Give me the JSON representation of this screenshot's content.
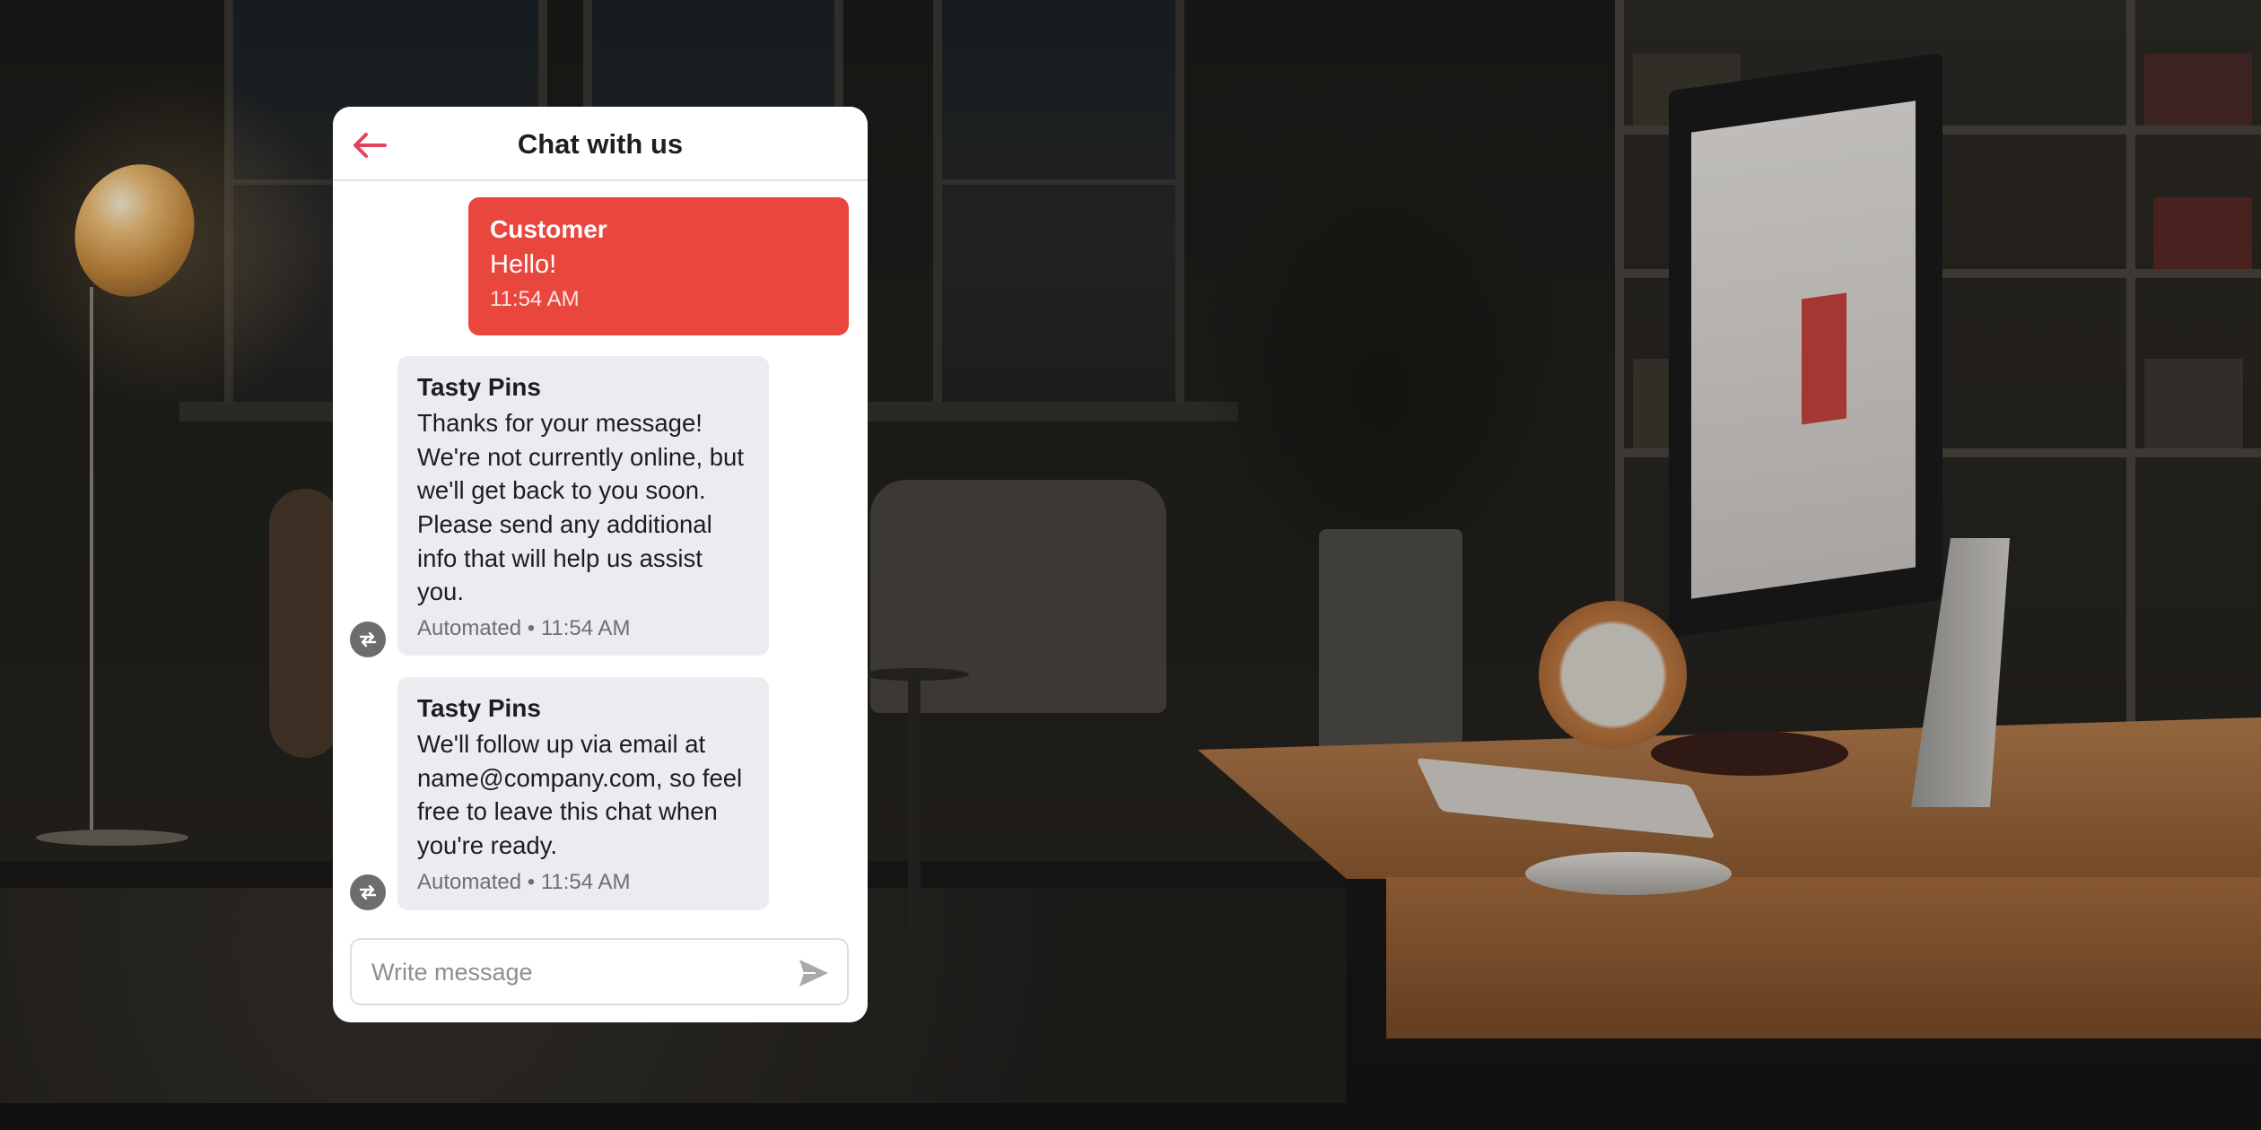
{
  "header": {
    "title": "Chat with us",
    "back_icon": "arrow-left-icon",
    "accent_color": "#e0455d"
  },
  "messages": [
    {
      "role": "customer",
      "sender": "Customer",
      "text": "Hello!",
      "time": "11:54 AM",
      "color": "#e9473e"
    },
    {
      "role": "bot",
      "sender": "Tasty Pins",
      "text": "Thanks for your message! We're not currently online, but we'll get back to you soon. Please send any additional info that will help us assist you.",
      "meta": "Automated • 11:54 AM",
      "icon": "automated-repeat-icon"
    },
    {
      "role": "bot",
      "sender": "Tasty Pins",
      "text": "We'll follow up via email at name@company.com, so feel free to leave this chat when you're ready.",
      "meta": "Automated • 11:54 AM",
      "icon": "automated-repeat-icon"
    }
  ],
  "composer": {
    "placeholder": "Write message",
    "value": "",
    "send_icon": "send-icon"
  }
}
